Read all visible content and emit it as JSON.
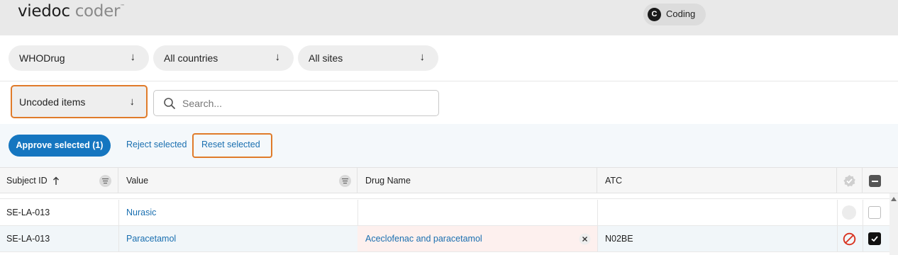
{
  "header": {
    "logo_primary": "viedoc",
    "logo_secondary": "coder",
    "logo_mark": "™",
    "user_initial": "C",
    "module_label": "Coding"
  },
  "filters": {
    "dictionary": "WHODrug",
    "countries": "All countries",
    "sites": "All sites",
    "status": "Uncoded items",
    "arrow": "↓"
  },
  "search": {
    "placeholder": "Search..."
  },
  "actions": {
    "approve_label": "Approve selected (1)",
    "reject_label": "Reject selected",
    "reset_label": "Reset selected"
  },
  "table": {
    "columns": {
      "subject_id": "Subject ID",
      "value": "Value",
      "drug_name": "Drug Name",
      "atc": "ATC"
    },
    "rows": [
      {
        "subject_id": "SE-LA-013",
        "value": "Nurasic",
        "drug_name": "",
        "atc": "",
        "selected": false,
        "status": "empty"
      },
      {
        "subject_id": "SE-LA-013",
        "value": "Paracetamol",
        "drug_name": "Aceclofenac and paracetamol",
        "atc": "N02BE",
        "selected": true,
        "status": "rejected"
      }
    ]
  },
  "colors": {
    "accent": "#1576c0",
    "highlight": "#e07b2a",
    "link": "#1a6fb0",
    "row_selected": "#f1f6f9",
    "drug_cell_tint": "#fdf0ee",
    "reject_icon": "#d9321f"
  }
}
